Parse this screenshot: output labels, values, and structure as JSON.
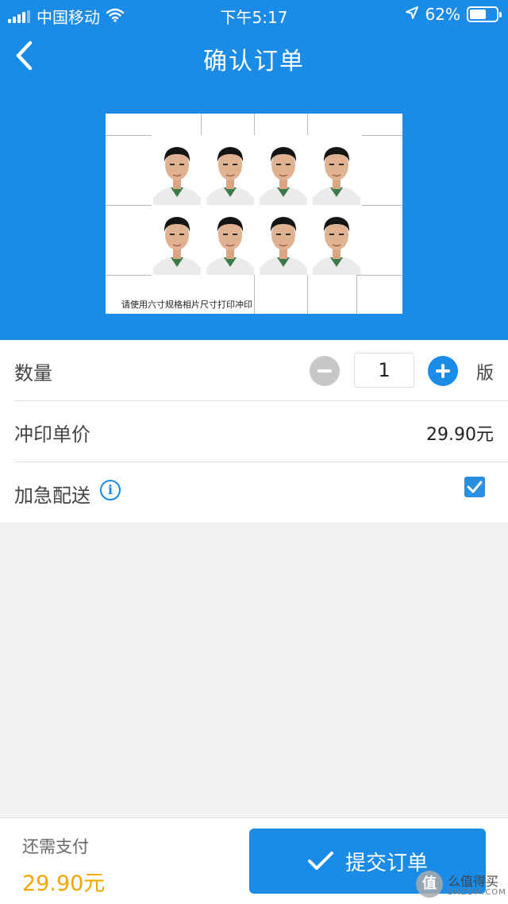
{
  "status_bar": {
    "carrier": "中国移动",
    "time": "下午5:17",
    "battery": "62%",
    "battery_level": 0.62
  },
  "nav": {
    "title": "确认订单"
  },
  "preview": {
    "caption": "请使用六寸规格相片尺寸打印冲印",
    "photo_count": 8
  },
  "order": {
    "quantity_label": "数量",
    "quantity_value": "1",
    "quantity_unit": "版",
    "price_label": "冲印单价",
    "price_value": "29.90元",
    "express_label": "加急配送",
    "express_checked": true
  },
  "footer": {
    "pay_label": "还需支付",
    "pay_amount": "29.90元",
    "submit_label": "提交订单"
  },
  "watermark": {
    "badge": "值",
    "text": "么值得买",
    "sub": "SMZDM.COM"
  },
  "colors": {
    "primary": "#1a8be6",
    "amount": "#f3a500",
    "background": "#f2f2f2"
  }
}
